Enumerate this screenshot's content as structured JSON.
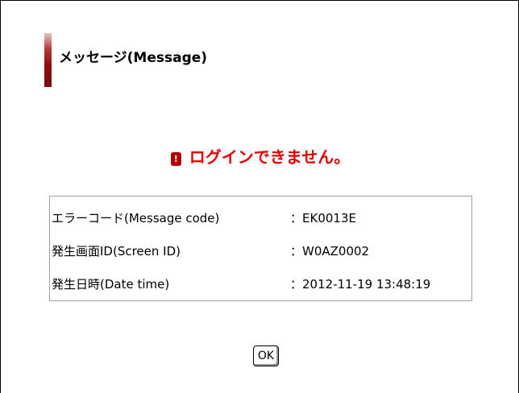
{
  "title": "メッセージ(Message)",
  "error": {
    "icon": "error-icon",
    "icon_glyph": "!",
    "message": "ログインできません。",
    "color": "#e00000"
  },
  "details": [
    {
      "label": "エラーコード(Message code)",
      "value": "：EK0013E"
    },
    {
      "label": "発生画面ID(Screen ID)",
      "value": "：W0AZ0002"
    },
    {
      "label": "発生日時(Date time)",
      "value": "：2012-11-19 13:48:19"
    }
  ],
  "ok_button": {
    "label": "OK"
  },
  "accent_color": "#8c0f0f"
}
